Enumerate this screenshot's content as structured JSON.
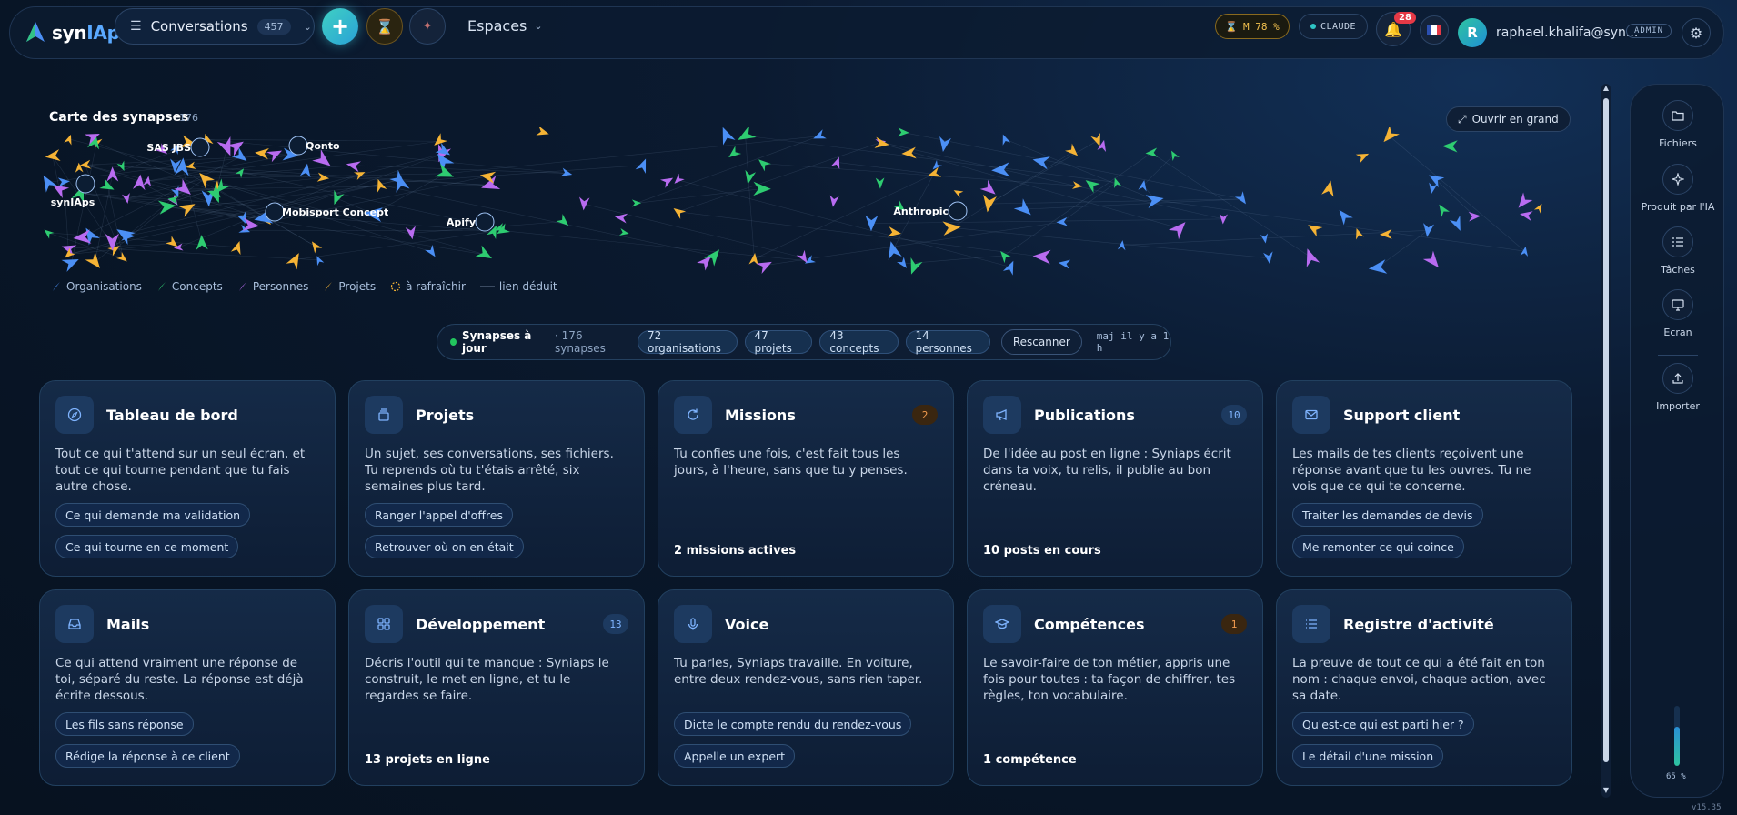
{
  "app": {
    "name_prefix": "syn",
    "name_highlight": "IAps",
    "version": "v15.35"
  },
  "header": {
    "conversations_label": "Conversations",
    "conversations_count": "457",
    "espaces_label": "Espaces",
    "m_badge": "M 78 %",
    "claude_badge": "CLAUDE",
    "notifications_count": "28",
    "avatar_initial": "R",
    "user_email": "raphael.khalifa@syn...",
    "role_badge": "ADMIN"
  },
  "map": {
    "title": "Carte des synapses",
    "count": "176",
    "open_big": "Ouvrir en grand",
    "labels": [
      "SAS JBS",
      "Qonto",
      "synIAps",
      "Mobisport Concept",
      "Apify",
      "Anthropic"
    ],
    "legend": {
      "organisations": "Organisations",
      "concepts": "Concepts",
      "personnes": "Personnes",
      "projets": "Projets",
      "refresh": "à rafraîchir",
      "deduced": "lien déduit"
    },
    "colors": {
      "organisations": "#4b8ff5",
      "concepts": "#2ecc71",
      "personnes": "#b86bf0",
      "projets": "#f5b335"
    }
  },
  "status": {
    "main": "Synapses à jour",
    "sub": "· 176 synapses",
    "chips": [
      "72 organisations",
      "47 projets",
      "43 concepts",
      "14 personnes"
    ],
    "rescan": "Rescanner",
    "updated": "maj il y a 1 h"
  },
  "cards": [
    {
      "title": "Tableau de bord",
      "count": "",
      "desc": "Tout ce qui t'attend sur un seul écran, et tout ce qui tourne pendant que tu fais autre chose.",
      "actions": [
        "Ce qui demande ma validation",
        "Ce qui tourne en ce moment"
      ],
      "footer": ""
    },
    {
      "title": "Projets",
      "count": "",
      "desc": "Un sujet, ses conversations, ses fichiers. Tu reprends où tu t'étais arrêté, six semaines plus tard.",
      "actions": [
        "Ranger l'appel d'offres",
        "Retrouver où on en était"
      ],
      "footer": ""
    },
    {
      "title": "Missions",
      "count": "2",
      "desc": "Tu confies une fois, c'est fait tous les jours, à l'heure, sans que tu y penses.",
      "actions": [],
      "footer": "2 missions actives"
    },
    {
      "title": "Publications",
      "count": "10",
      "desc": "De l'idée au post en ligne : Syniaps écrit dans ta voix, tu relis, il publie au bon créneau.",
      "actions": [],
      "footer": "10 posts en cours"
    },
    {
      "title": "Support client",
      "count": "",
      "desc": "Les mails de tes clients reçoivent une réponse avant que tu les ouvres. Tu ne vois que ce qui te concerne.",
      "actions": [
        "Traiter les demandes de devis",
        "Me remonter ce qui coince"
      ],
      "footer": ""
    },
    {
      "title": "Mails",
      "count": "",
      "desc": "Ce qui attend vraiment une réponse de toi, séparé du reste. La réponse est déjà écrite dessous.",
      "actions": [
        "Les fils sans réponse",
        "Rédige la réponse à ce client"
      ],
      "footer": ""
    },
    {
      "title": "Développement",
      "count": "13",
      "desc": "Décris l'outil qui te manque : Syniaps le construit, le met en ligne, et tu le regardes se faire.",
      "actions": [],
      "footer": "13 projets en ligne"
    },
    {
      "title": "Voice",
      "count": "",
      "desc": "Tu parles, Syniaps travaille. En voiture, entre deux rendez-vous, sans rien taper.",
      "actions": [
        "Dicte le compte rendu du rendez-vous",
        "Appelle un expert"
      ],
      "footer": ""
    },
    {
      "title": "Compétences",
      "count": "1",
      "desc": "Le savoir-faire de ton métier, appris une fois pour toutes : ta façon de chiffrer, tes règles, ton vocabulaire.",
      "actions": [],
      "footer": "1 compétence"
    },
    {
      "title": "Registre d'activité",
      "count": "",
      "desc": "La preuve de tout ce qui a été fait en ton nom : chaque envoi, chaque action, avec sa date.",
      "actions": [
        "Qu'est-ce qui est parti hier ?",
        "Le détail d'une mission"
      ],
      "footer": ""
    }
  ],
  "dock": {
    "items": [
      "Fichiers",
      "Produit par l'IA",
      "Tâches",
      "Ecran",
      "Importer"
    ],
    "gauge_label": "65 %",
    "gauge_value": 0.65
  }
}
